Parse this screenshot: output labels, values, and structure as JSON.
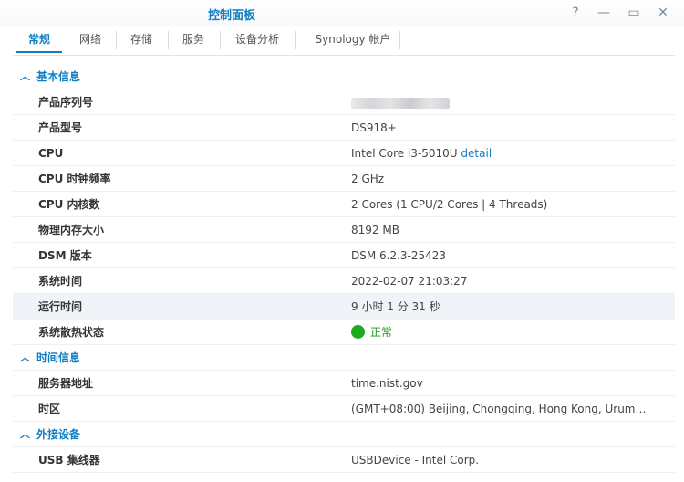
{
  "window": {
    "title": "控制面板"
  },
  "tabs": [
    "常规",
    "网络",
    "存储",
    "服务",
    "设备分析",
    "Synology 帐户"
  ],
  "sections": {
    "basic": {
      "title": "基本信息",
      "rows": [
        {
          "key": "产品序列号",
          "value": ""
        },
        {
          "key": "产品型号",
          "value": "DS918+"
        },
        {
          "key": "CPU",
          "value": "Intel Core i3-5010U",
          "link": "detail"
        },
        {
          "key": "CPU 时钟频率",
          "value": "2 GHz"
        },
        {
          "key": "CPU 内核数",
          "value": "2 Cores (1 CPU/2 Cores | 4 Threads)"
        },
        {
          "key": "物理内存大小",
          "value": "8192 MB"
        },
        {
          "key": "DSM 版本",
          "value": "DSM 6.2.3-25423"
        },
        {
          "key": "系统时间",
          "value": "2022-02-07 21:03:27"
        },
        {
          "key": "运行时间",
          "value": "9 小时 1 分 31 秒"
        },
        {
          "key": "系统散热状态",
          "value": "正常",
          "status_color": "#1faa1f"
        }
      ]
    },
    "time": {
      "title": "时间信息",
      "rows": [
        {
          "key": "服务器地址",
          "value": "time.nist.gov"
        },
        {
          "key": "时区",
          "value": "(GMT+08:00) Beijing, Chongqing, Hong Kong, Urum…"
        }
      ]
    },
    "external": {
      "title": "外接设备",
      "rows": [
        {
          "key": "USB 集线器",
          "value": "USBDevice - Intel Corp."
        }
      ]
    }
  },
  "colors": {
    "accent": "#0f7ec4",
    "ok": "#1faa1f"
  }
}
